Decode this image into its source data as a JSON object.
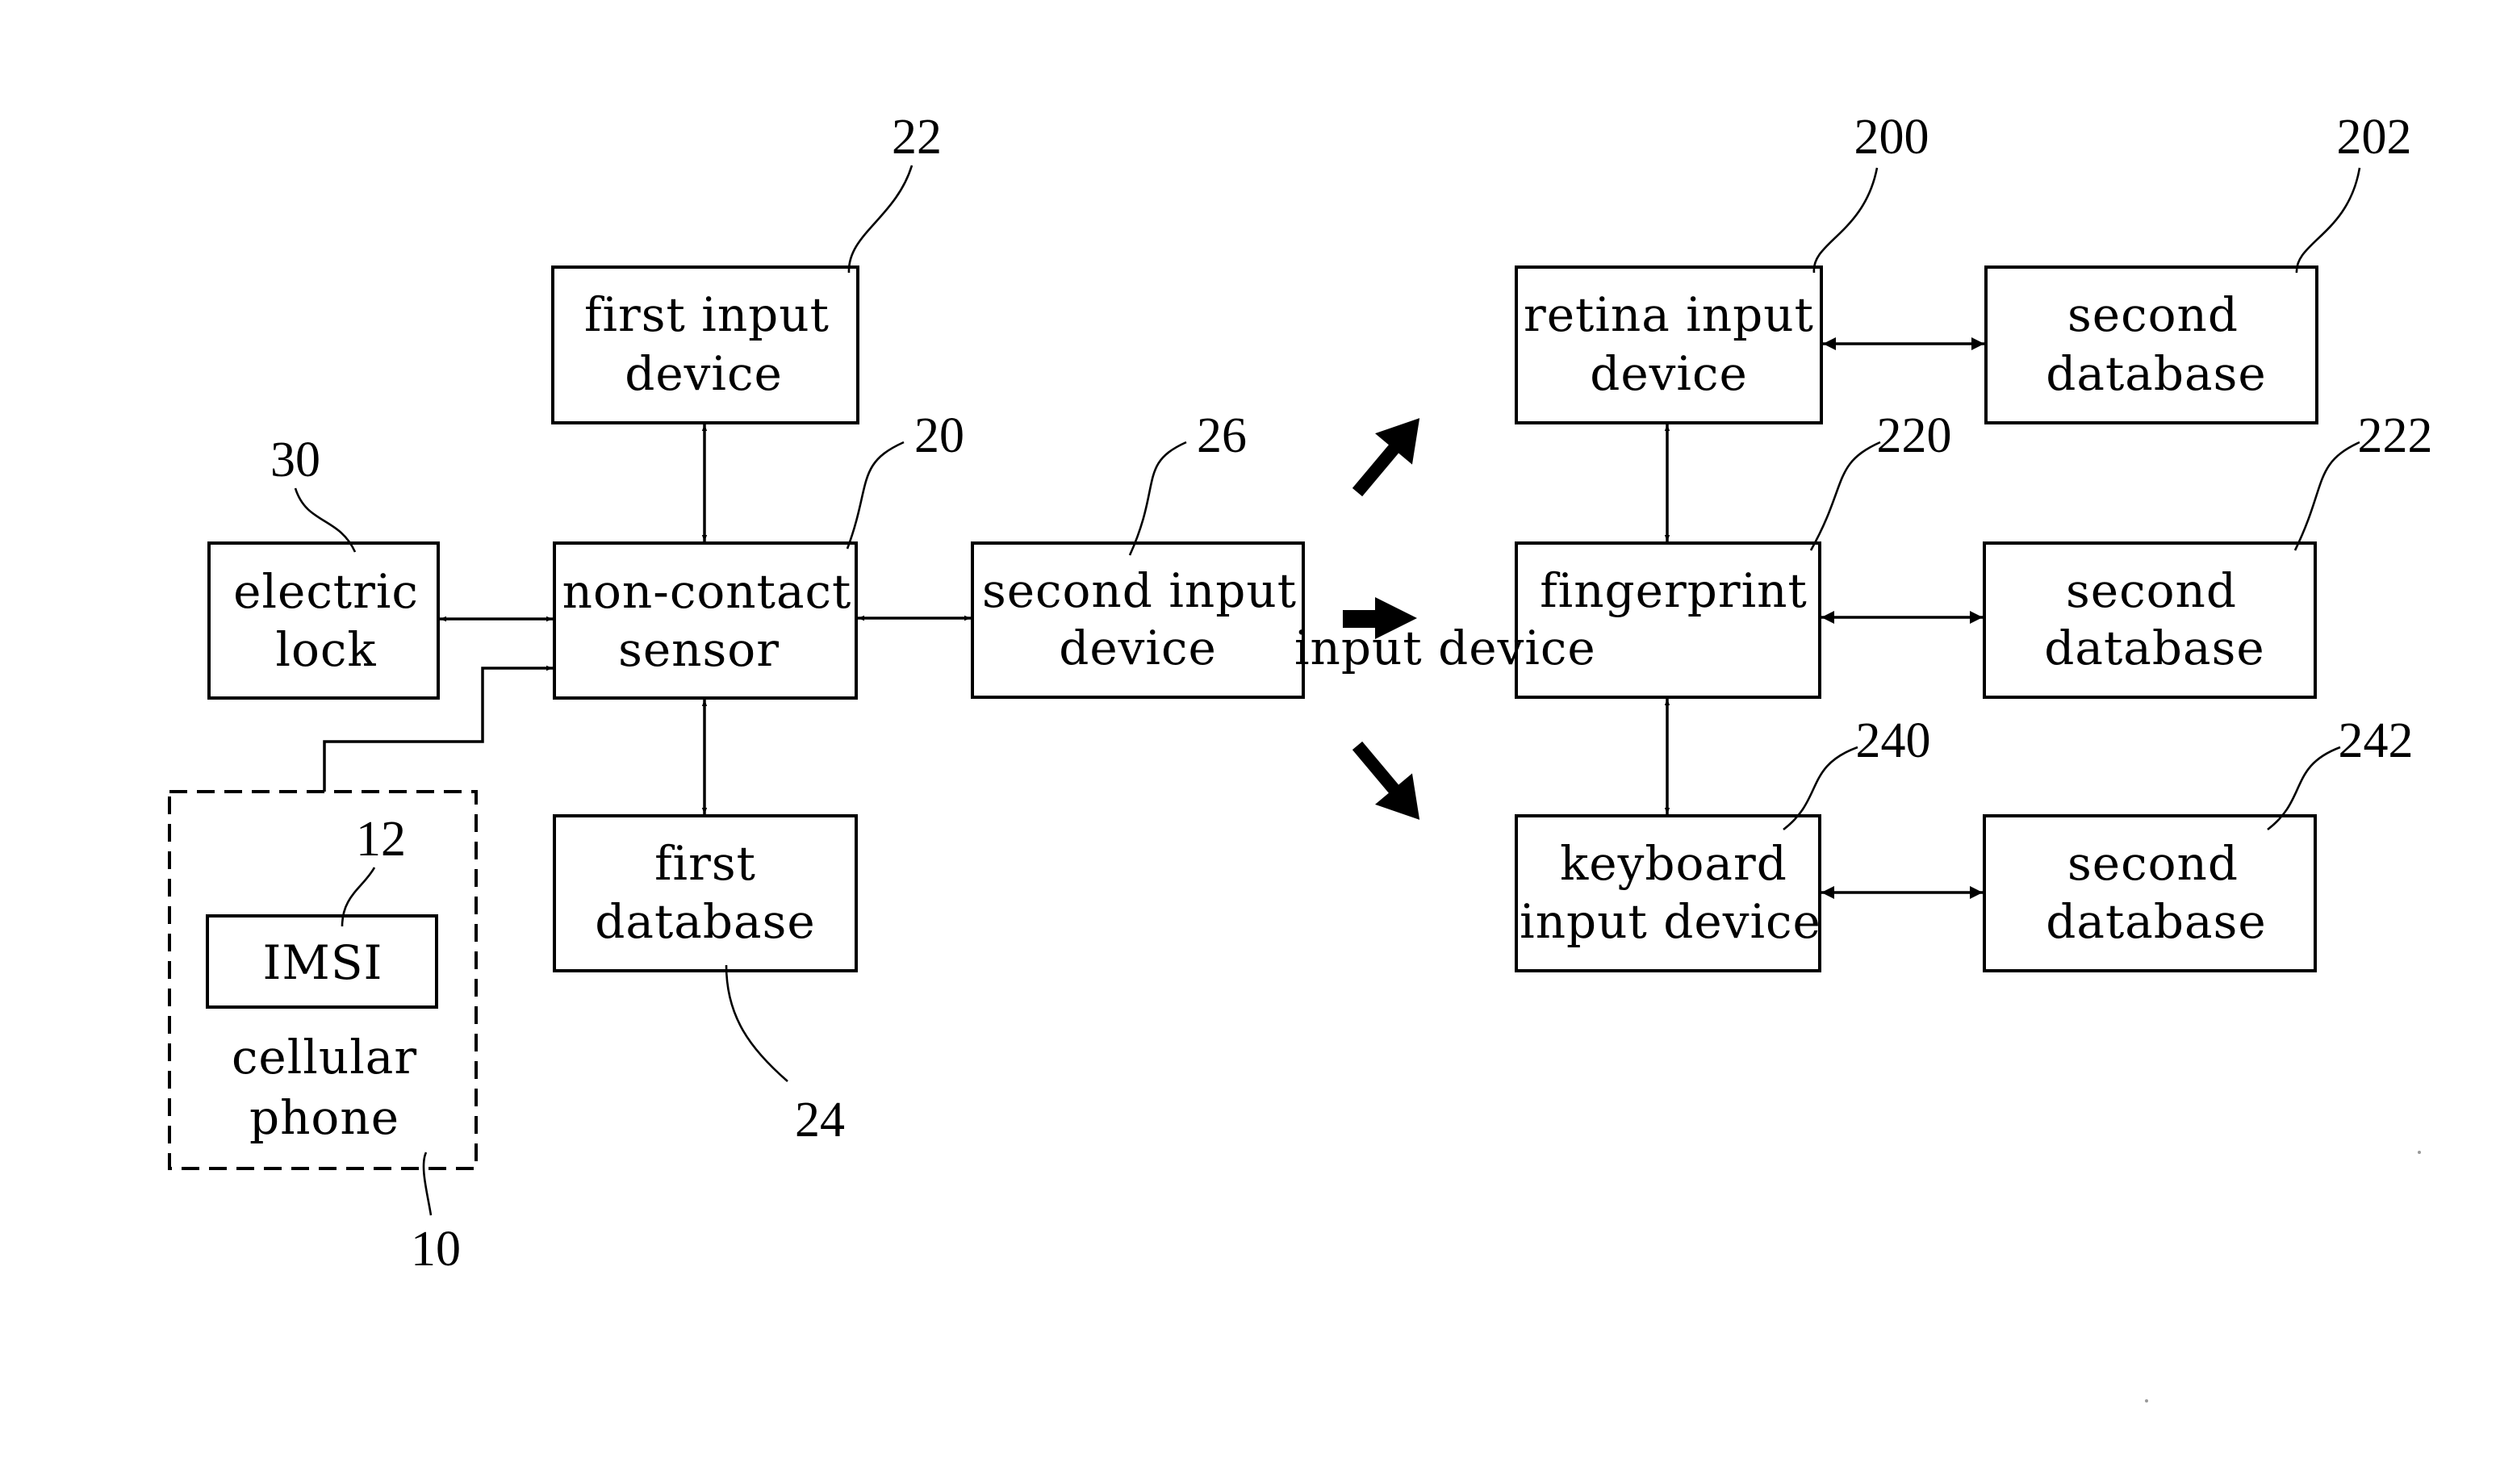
{
  "figure": {
    "type": "block-diagram",
    "blocks": [
      {
        "id": "electric-lock",
        "ref": "30",
        "lines": [
          "electric",
          "lock"
        ]
      },
      {
        "id": "non-contact-sensor",
        "ref": "20",
        "lines": [
          "non-contact",
          "sensor"
        ]
      },
      {
        "id": "first-input-device",
        "ref": "22",
        "lines": [
          "first input",
          "device"
        ]
      },
      {
        "id": "first-database",
        "ref": "24",
        "lines": [
          "first",
          "database"
        ]
      },
      {
        "id": "second-input-device",
        "ref": "26",
        "lines": [
          "second input",
          "device"
        ]
      },
      {
        "id": "cellular-phone",
        "ref": "10",
        "lines": [
          "cellular",
          "phone"
        ],
        "style": "dashed"
      },
      {
        "id": "imsi",
        "ref": "12",
        "lines": [
          "IMSI"
        ]
      },
      {
        "id": "retina-input-device",
        "ref": "200",
        "lines": [
          "retina input",
          "device"
        ]
      },
      {
        "id": "fingerprint",
        "ref": "220",
        "lines": [
          "fingerprint"
        ]
      },
      {
        "id": "keyboard-input-device",
        "ref": "240",
        "lines": [
          "keyboard",
          "input device"
        ]
      },
      {
        "id": "second-database-202",
        "ref": "202",
        "lines": [
          "second",
          "database"
        ]
      },
      {
        "id": "second-database-222",
        "ref": "222",
        "lines": [
          "second",
          "database"
        ]
      },
      {
        "id": "second-database-242",
        "ref": "242",
        "lines": [
          "second",
          "database"
        ]
      }
    ],
    "overlay_text": "input device",
    "connections": [
      {
        "from": "electric-lock",
        "to": "non-contact-sensor",
        "type": "bidirectional"
      },
      {
        "from": "first-input-device",
        "to": "non-contact-sensor",
        "type": "bidirectional"
      },
      {
        "from": "non-contact-sensor",
        "to": "first-database",
        "type": "bidirectional"
      },
      {
        "from": "non-contact-sensor",
        "to": "second-input-device",
        "type": "bidirectional"
      },
      {
        "from": "cellular-phone",
        "to": "non-contact-sensor",
        "type": "directed"
      },
      {
        "from": "retina-input-device",
        "to": "fingerprint",
        "type": "bidirectional"
      },
      {
        "from": "fingerprint",
        "to": "keyboard-input-device",
        "type": "bidirectional"
      },
      {
        "from": "retina-input-device",
        "to": "second-database-202",
        "type": "bidirectional"
      },
      {
        "from": "fingerprint",
        "to": "second-database-222",
        "type": "bidirectional"
      },
      {
        "from": "keyboard-input-device",
        "to": "second-database-242",
        "type": "bidirectional"
      },
      {
        "from": "second-input-device",
        "to": "retina-input-device",
        "type": "expands-to"
      },
      {
        "from": "second-input-device",
        "to": "fingerprint",
        "type": "expands-to"
      },
      {
        "from": "second-input-device",
        "to": "keyboard-input-device",
        "type": "expands-to"
      }
    ]
  }
}
